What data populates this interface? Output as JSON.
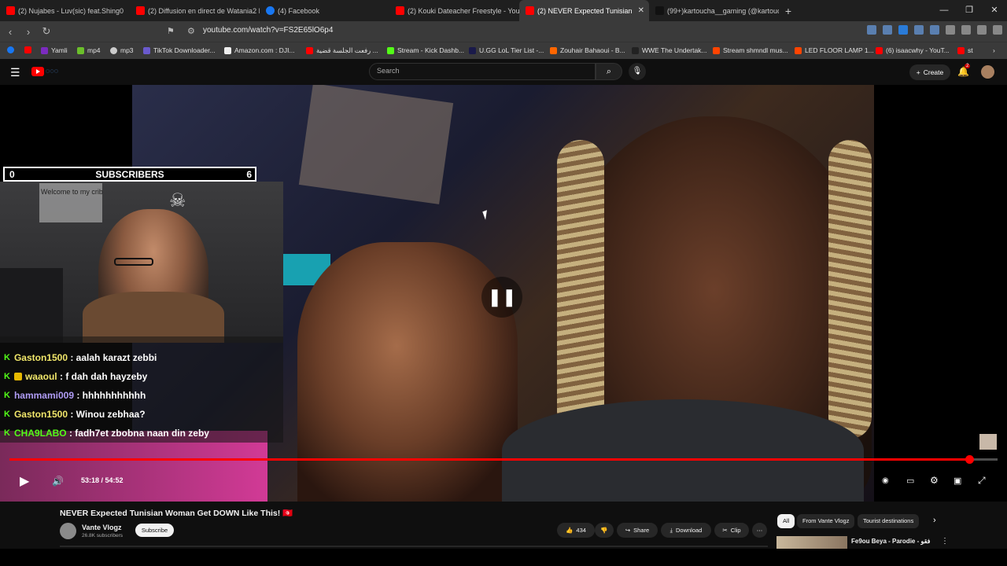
{
  "tabs": [
    {
      "title": "(2) Nujabes - Luv(sic) feat.Shing0",
      "active": false,
      "color": "#ff0000"
    },
    {
      "title": "(2) Diffusion en direct de Watania2 R",
      "active": false,
      "color": "#ff0000"
    },
    {
      "title": "(4) Facebook",
      "active": false,
      "color": "#1877f2"
    },
    {
      "title": "(2) Kouki Dateacher Freestyle - YouTu",
      "active": false,
      "color": "#ff0000"
    },
    {
      "title": "(2) NEVER Expected Tunisian",
      "active": true,
      "color": "#ff0000"
    },
    {
      "title": "(99+)kartoucha__gaming (@kartouch",
      "active": false,
      "color": "#111111"
    }
  ],
  "url": "youtube.com/watch?v=FS2E65lO6p4",
  "bookmarks": [
    {
      "label": "",
      "color": "#1877f2"
    },
    {
      "label": "",
      "color": "#ff0000"
    },
    {
      "label": "Yamli",
      "color": "#7b2bbf"
    },
    {
      "label": "mp4",
      "color": "#6bbf2b"
    },
    {
      "label": "mp3",
      "color": "#cccccc"
    },
    {
      "label": "TikTok Downloader...",
      "color": "#6a5acd"
    },
    {
      "label": "Amazon.com : DJI...",
      "color": "#eeeeee"
    },
    {
      "label": "رفعت الجلسة قضية ...",
      "color": "#ff0000"
    },
    {
      "label": "Stream - Kick Dashb...",
      "color": "#53fc18"
    },
    {
      "label": "U.GG LoL Tier List -...",
      "color": "#1a1a4a"
    },
    {
      "label": "Zouhair Bahaoui - B...",
      "color": "#ff6600"
    },
    {
      "label": "WWE The Undertak...",
      "color": "#222222"
    },
    {
      "label": "Stream shmndl mus...",
      "color": "#ff4400"
    },
    {
      "label": "LED FLOOR LAMP 1...",
      "color": "#ff4400"
    },
    {
      "label": "(6) isaacwhy - YouT...",
      "color": "#ff0000"
    },
    {
      "label": "st",
      "color": "#ff0000"
    }
  ],
  "search": {
    "placeholder": "Search"
  },
  "header": {
    "create": "Create",
    "notifications": "2"
  },
  "overlay": {
    "left": "0",
    "center": "SUBSCRIBERS",
    "right": "6"
  },
  "webcam": {
    "poster_text": "Welcome to my crib"
  },
  "chat": [
    {
      "user": "Gaston1500",
      "color": "#f0e66a",
      "msg": "aalah karazt zebbi",
      "sub": false
    },
    {
      "user": "waaoul",
      "color": "#f0e66a",
      "msg": "f dah dah hayzeby",
      "sub": true
    },
    {
      "user": "hammami009",
      "color": "#b09cf5",
      "msg": "hhhhhhhhhhh",
      "sub": false
    },
    {
      "user": "Gaston1500",
      "color": "#f0e66a",
      "msg": "Winou zebhaa?",
      "sub": false
    },
    {
      "user": "CHA9LABO",
      "color": "#53fc18",
      "msg": "fadh7et zbobna naan din zeby",
      "sub": false
    }
  ],
  "player": {
    "time": "53:18 / 54:52",
    "progress": 0.9714
  },
  "video": {
    "title": "NEVER Expected Tunisian Woman Get DOWN Like This! 🇹🇳",
    "channel": "Vante Vlogz",
    "subscribers": "26.8K subscribers",
    "subscribe": "Subscribe",
    "likes": "434",
    "share": "Share",
    "download": "Download",
    "clip": "Clip"
  },
  "chips": [
    "All",
    "From Vante Vlogz",
    "Tourist destinations"
  ],
  "recommended": {
    "title": "Fe9ou Beya - Parodie - فقو"
  }
}
